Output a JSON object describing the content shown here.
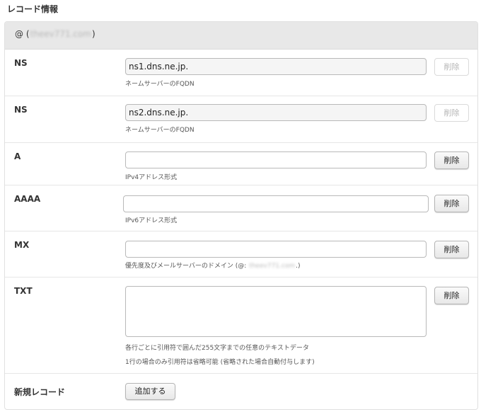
{
  "section_title": "レコード情報",
  "panel_header": {
    "at": "@",
    "open_paren": "(",
    "domain": "theev771.com",
    "close_paren": ")"
  },
  "rows": [
    {
      "type": "NS",
      "value": "ns1.dns.ne.jp.",
      "placeholder": "",
      "help": "ネームサーバーのFQDN",
      "delete_label": "削除",
      "delete_enabled": false
    },
    {
      "type": "NS",
      "value": "ns2.dns.ne.jp.",
      "placeholder": "",
      "help": "ネームサーバーのFQDN",
      "delete_label": "削除",
      "delete_enabled": false
    },
    {
      "type": "A",
      "value": "",
      "placeholder": "",
      "help": "IPv4アドレス形式",
      "delete_label": "削除",
      "delete_enabled": true
    },
    {
      "type": "AAAA",
      "value": "",
      "placeholder": "",
      "help": "IPv6アドレス形式",
      "delete_label": "削除",
      "delete_enabled": true
    },
    {
      "type": "MX",
      "value": "",
      "placeholder": "",
      "help_prefix": "優先度及びメールサーバーのドメイン (@:",
      "help_domain": "theev771.com",
      "help_suffix": ".)",
      "delete_label": "削除",
      "delete_enabled": true
    },
    {
      "type": "TXT",
      "value": "",
      "placeholder": "",
      "help": "各行ごとに引用符で囲んだ255文字までの任意のテキストデータ",
      "help2": "1行の場合のみ引用符は省略可能 (省略された場合自動付与します)",
      "delete_label": "削除",
      "delete_enabled": true
    }
  ],
  "new_record": {
    "label": "新規レコード",
    "add_label": "追加する"
  }
}
